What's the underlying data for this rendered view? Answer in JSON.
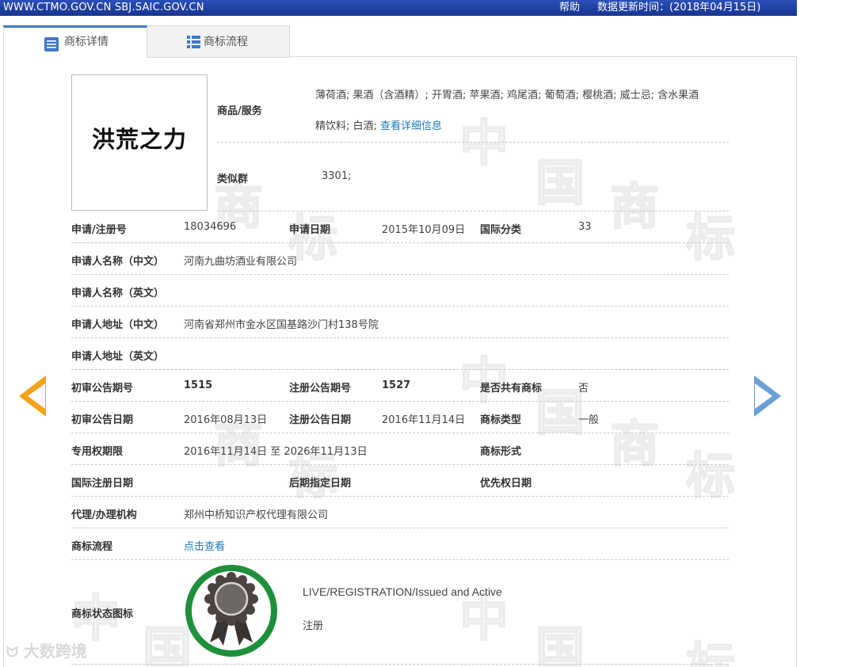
{
  "topbar": {
    "domains": "WWW.CTMO.GOV.CN SBJ.SAIC.GOV.CN",
    "help": "帮助",
    "update": "数据更新时间：(2018年04月15日)"
  },
  "tabs": [
    {
      "label": "商标详情",
      "icon": "document-list-icon",
      "active": true
    },
    {
      "label": "商标流程",
      "icon": "list-icon",
      "active": false
    }
  ],
  "trademark": {
    "mark_text": "洪荒之力",
    "goods_label": "商品/服务",
    "goods_line1": "薄荷酒; 果酒（含酒精）; 开胃酒; 苹果酒; 鸡尾酒; 葡萄酒; 樱桃酒; 威士忌; 含水果酒",
    "goods_line2": "精饮料; 白酒;",
    "goods_link": "查看详细信息",
    "similar_label": "类似群",
    "similar_value": "3301;"
  },
  "rows": {
    "reg_no_label": "申请/注册号",
    "reg_no": "18034696",
    "app_date_label": "申请日期",
    "app_date": "2015年10月09日",
    "intl_class_label": "国际分类",
    "intl_class": "33",
    "applicant_cn_label": "申请人名称（中文）",
    "applicant_cn": "河南九曲坊酒业有限公司",
    "applicant_en_label": "申请人名称（英文）",
    "address_cn_label": "申请人地址（中文）",
    "address_cn": "河南省郑州市金水区国基路沙门村138号院",
    "address_en_label": "申请人地址（英文）",
    "prelim_no_label": "初审公告期号",
    "prelim_no": "1515",
    "reg_pub_no_label": "注册公告期号",
    "reg_pub_no": "1527",
    "shared_label": "是否共有商标",
    "shared": "否",
    "prelim_date_label": "初审公告日期",
    "prelim_date": "2016年08月13日",
    "reg_pub_date_label": "注册公告日期",
    "reg_pub_date": "2016年11月14日",
    "tm_type_label": "商标类型",
    "tm_type": "一般",
    "term_label": "专用权期限",
    "term": "2016年11月14日 至 2026年11月13日",
    "tm_form_label": "商标形式",
    "intl_reg_date_label": "国际注册日期",
    "later_date_label": "后期指定日期",
    "priority_date_label": "优先权日期",
    "agent_label": "代理/办理机构",
    "agent": "郑州中桥知识产权代理有限公司",
    "flow_label": "商标流程",
    "flow_link": "点击查看",
    "status_label": "商标状态图标",
    "status_en": "LIVE/REGISTRATION/Issued and Active",
    "status_cn": "注册"
  },
  "bottom_logo": "大数跨境",
  "colors": {
    "topbar": "#1c3c9c",
    "tab_accent": "#3f78c6",
    "link": "#1a7ab8",
    "left_arrow": "#f2a11c",
    "right_arrow": "#6a9fd8",
    "badge_ring": "#1e8f3a"
  }
}
